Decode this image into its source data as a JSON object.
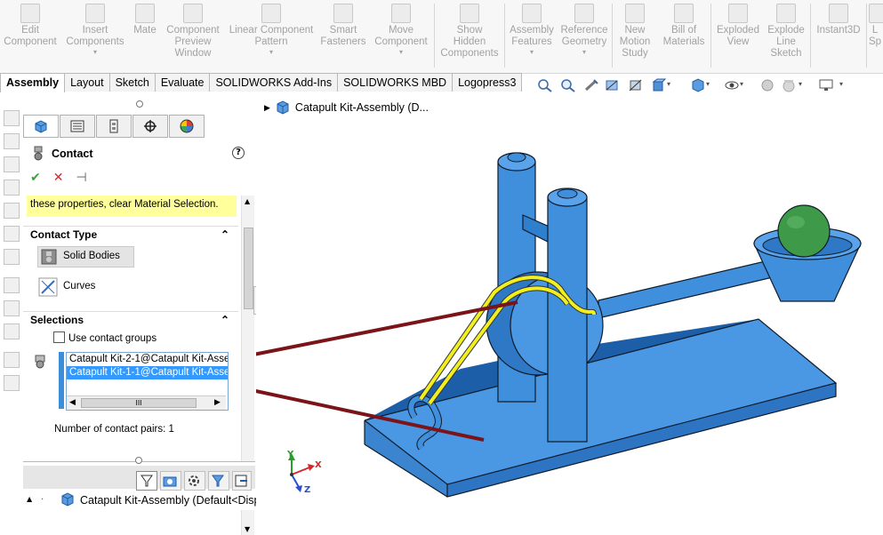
{
  "ribbon": {
    "buttons": [
      {
        "label": "Edit\nComponent",
        "dd": "",
        "icon": "edit-component-icon"
      },
      {
        "label": "Insert\nComponents",
        "dd": "▾",
        "icon": "insert-components-icon"
      },
      {
        "label": "Mate",
        "dd": "",
        "icon": "mate-icon"
      },
      {
        "label": "Component\nPreview\nWindow",
        "dd": "",
        "icon": "component-preview-icon"
      },
      {
        "label": "Linear Component\nPattern",
        "dd": "▾",
        "icon": "linear-pattern-icon"
      },
      {
        "label": "Smart\nFasteners",
        "dd": "",
        "icon": "smart-fasteners-icon"
      },
      {
        "label": "Move\nComponent",
        "dd": "▾",
        "icon": "move-component-icon"
      },
      {
        "label": "Show\nHidden\nComponents",
        "dd": "",
        "icon": "show-hidden-icon"
      },
      {
        "label": "Assembly\nFeatures",
        "dd": "▾",
        "icon": "assembly-features-icon"
      },
      {
        "label": "Reference\nGeometry",
        "dd": "▾",
        "icon": "reference-geometry-icon"
      },
      {
        "label": "New\nMotion\nStudy",
        "dd": "",
        "icon": "motion-study-icon"
      },
      {
        "label": "Bill of\nMaterials",
        "dd": "",
        "icon": "bill-of-materials-icon"
      },
      {
        "label": "Exploded\nView",
        "dd": "",
        "icon": "exploded-view-icon"
      },
      {
        "label": "Explode\nLine\nSketch",
        "dd": "",
        "icon": "explode-line-icon"
      },
      {
        "label": "Instant3D",
        "dd": "",
        "icon": "instant3d-icon"
      },
      {
        "label": "L\nSp",
        "dd": "",
        "icon": "large-assembly-icon"
      }
    ]
  },
  "tabs": [
    "Assembly",
    "Layout",
    "Sketch",
    "Evaluate",
    "SOLIDWORKS Add-Ins",
    "SOLIDWORKS MBD",
    "Logopress3"
  ],
  "panel": {
    "title": "Contact",
    "help": "?",
    "ok": "✔",
    "cancel": "✕",
    "pin": "⊣",
    "note": "these properties, clear Material Selection.",
    "contact_type": {
      "heading": "Contact Type",
      "solid_bodies": "Solid Bodies",
      "curves": "Curves"
    },
    "selections": {
      "heading": "Selections",
      "use_groups": "Use contact groups",
      "items": [
        "Catapult Kit-2-1@Catapult Kit-Asse",
        "Catapult Kit-1-1@Catapult Kit-Asse"
      ],
      "scroll_mid": "III",
      "pairs": "Number of contact pairs: 1"
    }
  },
  "bottom_tree": {
    "arrow": "▲",
    "label": "Catapult Kit-Assembly  (Default<Disp"
  },
  "graphics": {
    "tree_label": "Catapult Kit-Assembly  (D...",
    "axis_y": "Y",
    "axis_x": "X",
    "axis_z": "Z"
  },
  "colors": {
    "part_blue": "#3f8fdd",
    "part_dark": "#1d5ea8",
    "ball_green": "#3e9a48",
    "cable_yellow": "#f2ef1f",
    "leader_red": "#7a1418",
    "note_yellow": "#ffff9c"
  }
}
